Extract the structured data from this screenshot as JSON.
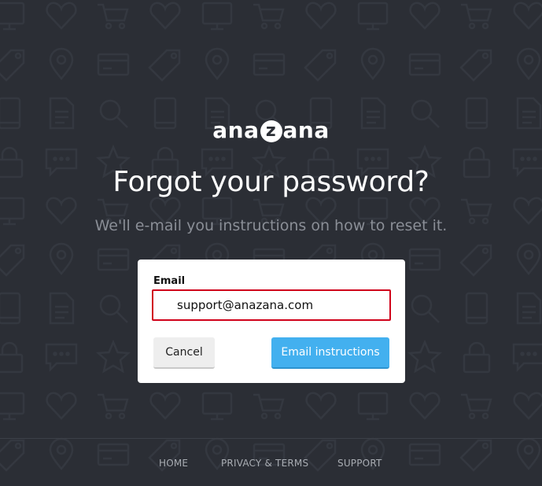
{
  "logo": {
    "before": "ana",
    "badge": "z",
    "after": "ana"
  },
  "heading": "Forgot your password?",
  "subheading": "We'll e-mail you instructions on how to reset it.",
  "form": {
    "email_label": "Email",
    "email_value": "support@anazana.com",
    "cancel_label": "Cancel",
    "submit_label": "Email instructions"
  },
  "footer": {
    "links": [
      "HOME",
      "PRIVACY & TERMS",
      "SUPPORT"
    ]
  },
  "colors": {
    "background": "#2b2e35",
    "accent": "#43b0ef",
    "error_border": "#d0021b"
  },
  "background_icons": [
    "monitor-icon",
    "heart-icon",
    "cart-icon",
    "tag-icon",
    "map-pin-icon",
    "credit-card-icon",
    "tablet-icon",
    "document-icon",
    "magnifier-icon",
    "lock-icon",
    "chat-icon",
    "star-icon"
  ]
}
